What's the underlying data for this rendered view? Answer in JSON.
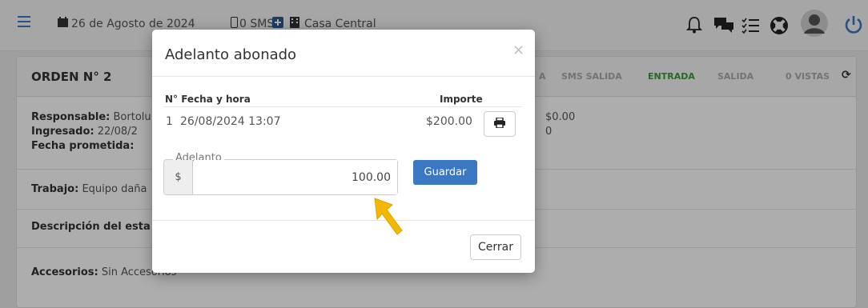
{
  "topbar": {
    "date": "26 de Agosto de 2024",
    "sms": "0 SMS",
    "branch": "Casa Central"
  },
  "order": {
    "title": "ORDEN N° 2",
    "tabs": [
      "A",
      "SMS SALIDA",
      "ENTRADA",
      "SALIDA",
      "0 VISTAS"
    ],
    "responsable_label": "Responsable:",
    "responsable_value": "Bortolu",
    "ingresado_label": "Ingresado:",
    "ingresado_value": "22/08/2",
    "fecha_label": "Fecha prometida:",
    "right_value": "$0.00",
    "right_value2": "0",
    "trabajo_label": "Trabajo:",
    "trabajo_value": "Equipo daña",
    "descripcion_label": "Descripción del esta",
    "accesorios_label": "Accesorios:",
    "accesorios_value": "Sin Accesorios"
  },
  "modal": {
    "title": "Adelanto abonado",
    "close_symbol": "×",
    "col_num_date": "N° Fecha y hora",
    "col_amount": "Importe",
    "rows": [
      {
        "num": "1",
        "date": "26/08/2024 13:07",
        "amount": "$200.00"
      }
    ],
    "field_label": "Adelanto",
    "currency": "$",
    "field_value": "100.00",
    "save_label": "Guardar",
    "close_label": "Cerrar"
  },
  "colors": {
    "primary": "#3a78c3",
    "entrada": "#3a9a3a",
    "arrow": "#f5b800"
  }
}
